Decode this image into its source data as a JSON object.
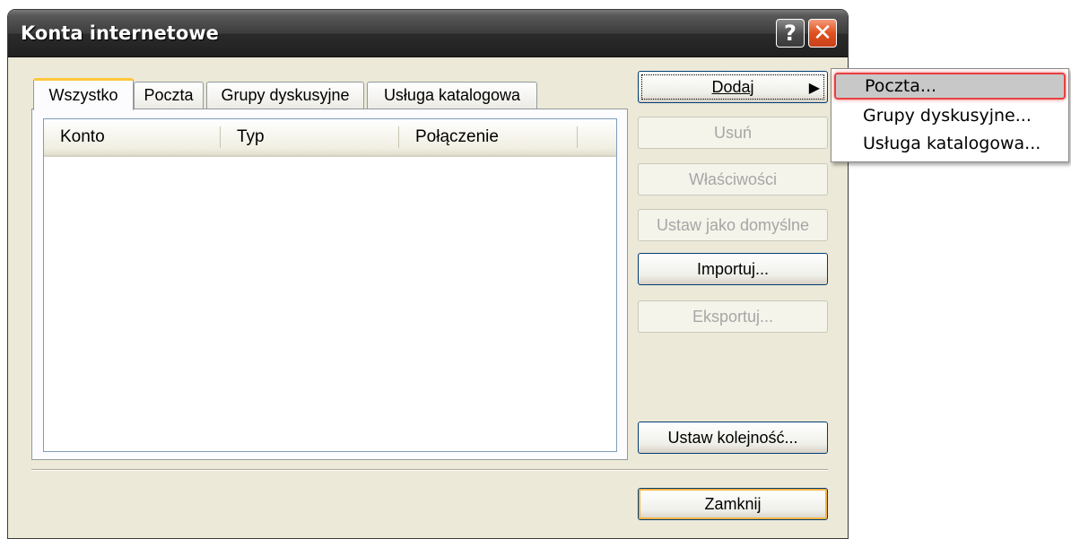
{
  "window": {
    "title": "Konta internetowe",
    "help_glyph": "?",
    "close_glyph": "✕"
  },
  "tabs": [
    {
      "label": "Wszystko",
      "active": true
    },
    {
      "label": "Poczta",
      "active": false
    },
    {
      "label": "Grupy dyskusyjne",
      "active": false
    },
    {
      "label": "Usługa katalogowa",
      "active": false
    }
  ],
  "list": {
    "columns": [
      "Konto",
      "Typ",
      "Połączenie"
    ],
    "rows": []
  },
  "buttons": {
    "add": "Dodaj",
    "add_arrow": "▶",
    "remove": "Usuń",
    "properties": "Właściwości",
    "set_default": "Ustaw jako domyślne",
    "import": "Importuj...",
    "export": "Eksportuj...",
    "set_order": "Ustaw kolejność...",
    "close": "Zamknij"
  },
  "add_menu": {
    "items": [
      "Poczta...",
      "Grupy dyskusyjne...",
      "Usługa katalogowa..."
    ],
    "highlighted_index": 0
  },
  "colors": {
    "dialog_bg": "#ece9d8",
    "titlebar": "#2b2b2b",
    "close_button": "#e0501f",
    "highlight_border": "#e84040",
    "default_button_ring": "#f3b443"
  }
}
